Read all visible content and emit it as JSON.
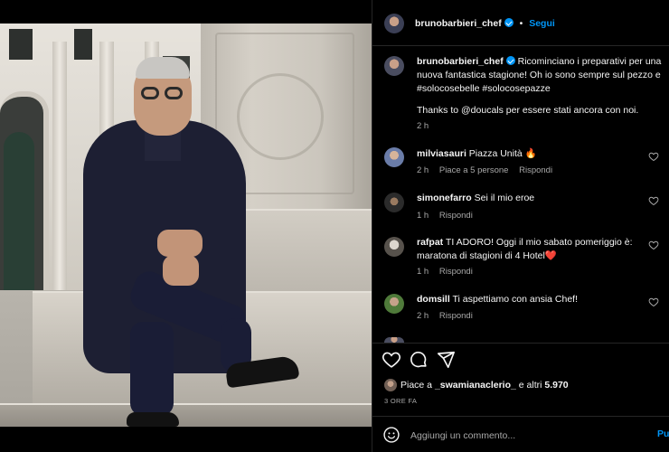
{
  "header": {
    "username": "brunobarbieri_chef",
    "separator": "•",
    "follow_label": "Segui"
  },
  "caption": {
    "username": "brunobarbieri_chef",
    "line1": "Ricominciano i preparativi per una",
    "line2": "nuova fantastica stagione! Oh io sono sempre sul pezzo e",
    "line3": "#solocosebelle #solocosepazze",
    "line4": "Thanks to @doucals per essere stati ancora con noi.",
    "time": "2 h"
  },
  "comments": [
    {
      "username": "milviasauri",
      "text": "Piazza Unità 🔥",
      "time": "2 h",
      "likes": "Piace a 5 persone",
      "reply": "Rispondi"
    },
    {
      "username": "simonefarro",
      "text": "Sei il mio eroe",
      "time": "1 h",
      "reply": "Rispondi"
    },
    {
      "username": "rafpat",
      "text": "TI ADORO! Oggi il mio sabato pomeriggio è:",
      "text2": "maratona di stagioni di 4 Hotel❤️",
      "time": "1 h",
      "reply": "Rispondi"
    },
    {
      "username": "domsill",
      "text": "Ti aspettiamo con ansia Chef!",
      "time": "2 h",
      "reply": "Rispondi"
    }
  ],
  "actions": {
    "like_icon": "heart-icon",
    "comment_icon": "comment-icon",
    "share_icon": "share-icon"
  },
  "likes": {
    "prefix": "Piace a",
    "user": "_swamianaclerio_",
    "suffix": "e altri",
    "count": "5.970"
  },
  "post_time": "3 ORE FA",
  "comment_box": {
    "placeholder": "Aggiungi un commento...",
    "post_label": "Pubblica",
    "post_label_visible": "Pu",
    "emoji_icon": "smiley-icon"
  },
  "colors": {
    "background": "#000000",
    "accent": "#0095f6",
    "muted_text": "#a8a8a8"
  }
}
